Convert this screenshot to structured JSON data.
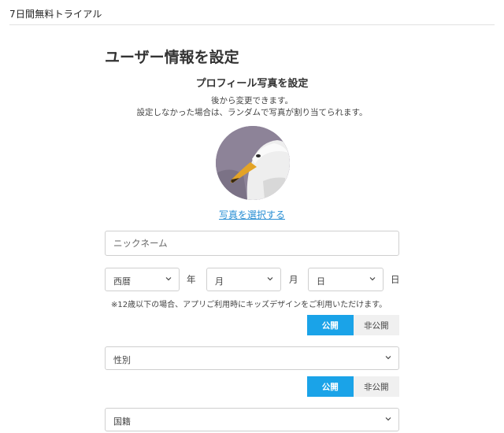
{
  "header": {
    "brand": "7日間無料トライアル"
  },
  "page_title": "ユーザー情報を設定",
  "photo": {
    "title": "プロフィール写真を設定",
    "desc_line1": "後から変更できます。",
    "desc_line2": "設定しなかった場合は、ランダムで写真が割り当てられます。",
    "select_link": "写真を選択する"
  },
  "nickname": {
    "placeholder": "ニックネーム",
    "value": ""
  },
  "birthday": {
    "era": "西暦",
    "year_unit": "年",
    "month": "月",
    "month_unit": "月",
    "day": "日",
    "day_unit": "日"
  },
  "note": "※12歳以下の場合、アプリご利用時にキッズデザインをご利用いただけます。",
  "visibility_birthday": {
    "public": "公開",
    "private": "非公開",
    "selected": "公開"
  },
  "gender": {
    "value": "性別"
  },
  "visibility_gender": {
    "public": "公開",
    "private": "非公開",
    "selected": "公開"
  },
  "nationality": {
    "value": "国籍"
  },
  "colors": {
    "accent": "#1aa3e8",
    "link": "#2a8fd4"
  }
}
